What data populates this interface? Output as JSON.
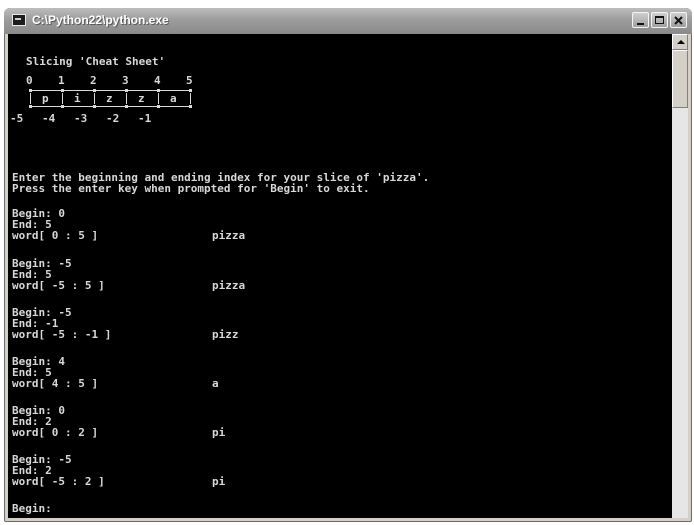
{
  "window": {
    "title": "C:\\Python22\\python.exe"
  },
  "console": {
    "heading": "Slicing 'Cheat Sheet'",
    "diagram": {
      "positive_indices": [
        "0",
        "1",
        "2",
        "3",
        "4",
        "5"
      ],
      "letters": [
        "p",
        "i",
        "z",
        "z",
        "a"
      ],
      "negative_indices": [
        "-5",
        "-4",
        "-3",
        "-2",
        "-1"
      ]
    },
    "intro_line_1": "Enter the beginning and ending index for your slice of 'pizza'.",
    "intro_line_2": "Press the enter key when prompted for 'Begin' to exit.",
    "sessions": [
      {
        "begin": "Begin: 0",
        "end": "End: 5",
        "expr": "word[ 0 : 5 ]",
        "result": "pizza"
      },
      {
        "begin": "Begin: -5",
        "end": "End: 5",
        "expr": "word[ -5 : 5 ]",
        "result": "pizza"
      },
      {
        "begin": "Begin: -5",
        "end": "End: -1",
        "expr": "word[ -5 : -1 ]",
        "result": "pizz"
      },
      {
        "begin": "Begin: 4",
        "end": "End: 5",
        "expr": "word[ 4 : 5 ]",
        "result": "a"
      },
      {
        "begin": "Begin: 0",
        "end": "End: 2",
        "expr": "word[ 0 : 2 ]",
        "result": "pi"
      },
      {
        "begin": "Begin: -5",
        "end": "End: 2",
        "expr": "word[ -5 : 2 ]",
        "result": "pi"
      }
    ],
    "prompt": "Begin:"
  },
  "colors": {
    "console_bg": "#000000",
    "console_text": "#d8d8d8",
    "titlebar": "#9c9c9c"
  },
  "icons": [
    "console-app-icon",
    "minimize-icon",
    "maximize-icon",
    "close-icon",
    "scroll-up-arrow-icon"
  ]
}
